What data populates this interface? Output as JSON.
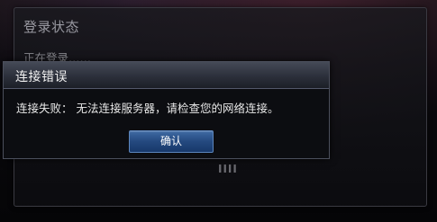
{
  "background_dialog": {
    "title": "登录状态",
    "status_text": "正在登录……",
    "partial_text": "IIII"
  },
  "error_modal": {
    "title": "连接错误",
    "message": "连接失败：  无法连接服务器，请检查您的网络连接。",
    "ok_label": "确认"
  }
}
